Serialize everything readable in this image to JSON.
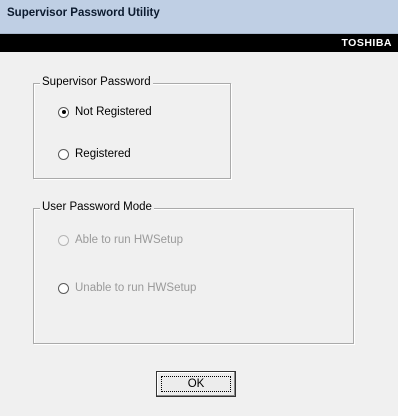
{
  "window": {
    "title": "Supervisor Password Utility",
    "brand": "TOSHIBA"
  },
  "supervisor_group": {
    "legend": "Supervisor Password",
    "options": [
      {
        "label": "Not Registered",
        "checked": true,
        "enabled": true
      },
      {
        "label": "Registered",
        "checked": false,
        "enabled": true
      }
    ]
  },
  "user_mode_group": {
    "legend": "User Password Mode",
    "options": [
      {
        "label": "Able to run HWSetup",
        "checked": false,
        "enabled": false
      },
      {
        "label": "Unable to run HWSetup",
        "checked": false,
        "enabled": false
      }
    ]
  },
  "buttons": {
    "ok_label": "OK"
  }
}
